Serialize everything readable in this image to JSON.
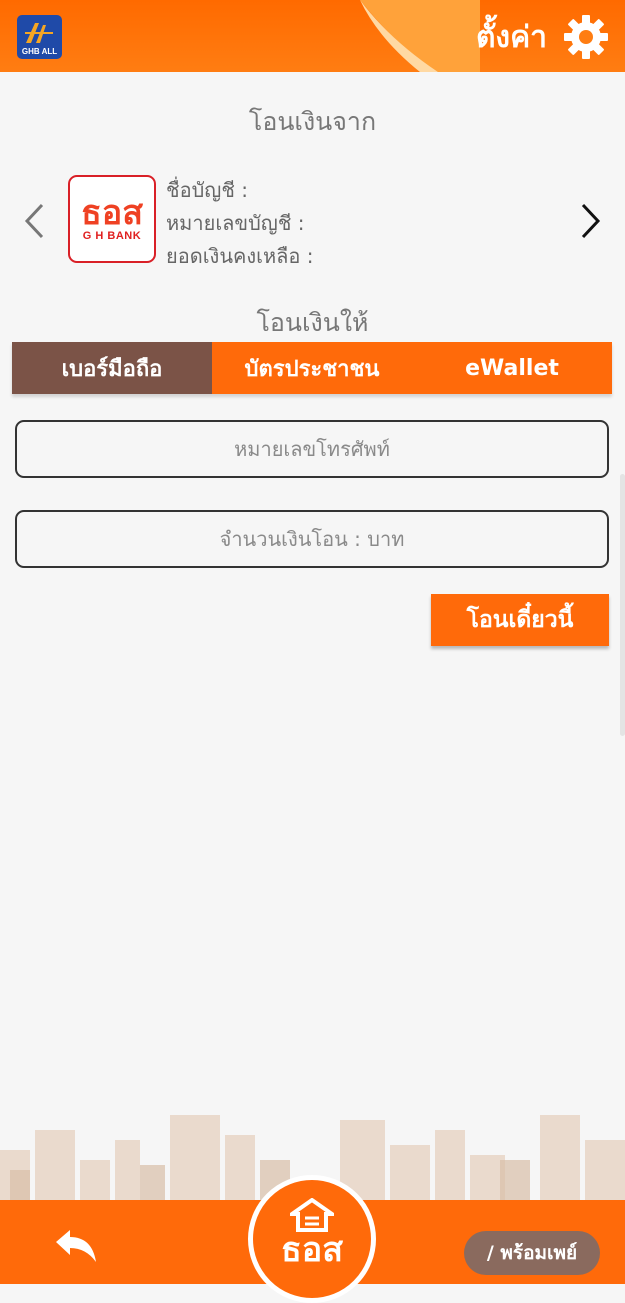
{
  "header": {
    "app_logo_text": "GHB ALL",
    "settings_label": "ตั้งค่า"
  },
  "transfer_from": {
    "title": "โอนเงินจาก",
    "bank_logo_main": "ธอส",
    "bank_logo_sub": "G H BANK",
    "account_name_label": "ชื่อบัญชี :",
    "account_number_label": "หมายเลขบัญชี :",
    "balance_label": "ยอดเงินคงเหลือ :"
  },
  "transfer_to": {
    "title": "โอนเงินให้",
    "tabs": [
      {
        "label": "เบอร์มือถือ",
        "active": true
      },
      {
        "label": "บัตรประชาชน",
        "active": false
      },
      {
        "label": "eWallet",
        "active": false
      }
    ],
    "phone_placeholder": "หมายเลขโทรศัพท์",
    "amount_placeholder": "จำนวนเงินโอน : บาท",
    "transfer_now_label": "โอนเดี๋ยวนี้"
  },
  "footer": {
    "center_logo_text": "ธอส",
    "promptpay_label": "/ พร้อมเพย์"
  },
  "colors": {
    "accent": "#ff6a0a",
    "active_tab": "#7b5347",
    "promptpay_bg": "#8a6a5e"
  }
}
